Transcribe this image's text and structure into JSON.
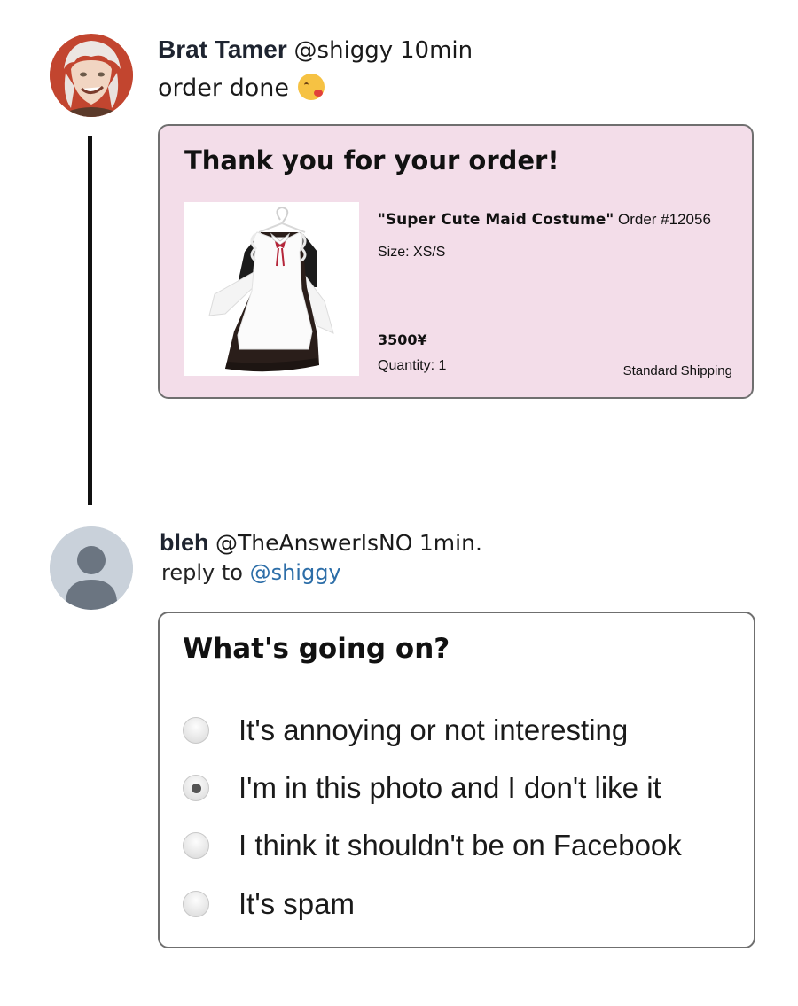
{
  "post": {
    "author_name": "Brat Tamer",
    "handle": "@shiggy",
    "time": "10min",
    "text": "order done",
    "emoji": "kissing-face-with-heart-emoji"
  },
  "order": {
    "title": "Thank you for your order!",
    "product_name": "\"Super Cute Maid Costume\"",
    "order_number": "Order #12056",
    "size": "Size: XS/S",
    "price": "3500¥",
    "quantity": "Quantity: 1",
    "shipping": "Standard Shipping",
    "card_color": "#f3dde9"
  },
  "reply": {
    "author_name": "bleh",
    "handle": "@TheAnswerIsNO",
    "time": "1min.",
    "reply_prefix": "reply to",
    "reply_mention": "@shiggy",
    "mention_color": "#2d6ea8"
  },
  "report": {
    "title": "What's going on?",
    "options": [
      {
        "label": "It's annoying or not interesting",
        "selected": false
      },
      {
        "label": "I'm in this photo and I don't like it",
        "selected": true
      },
      {
        "label": "I think it shouldn't be on Facebook",
        "selected": false
      },
      {
        "label": "It's spam",
        "selected": false
      }
    ]
  }
}
